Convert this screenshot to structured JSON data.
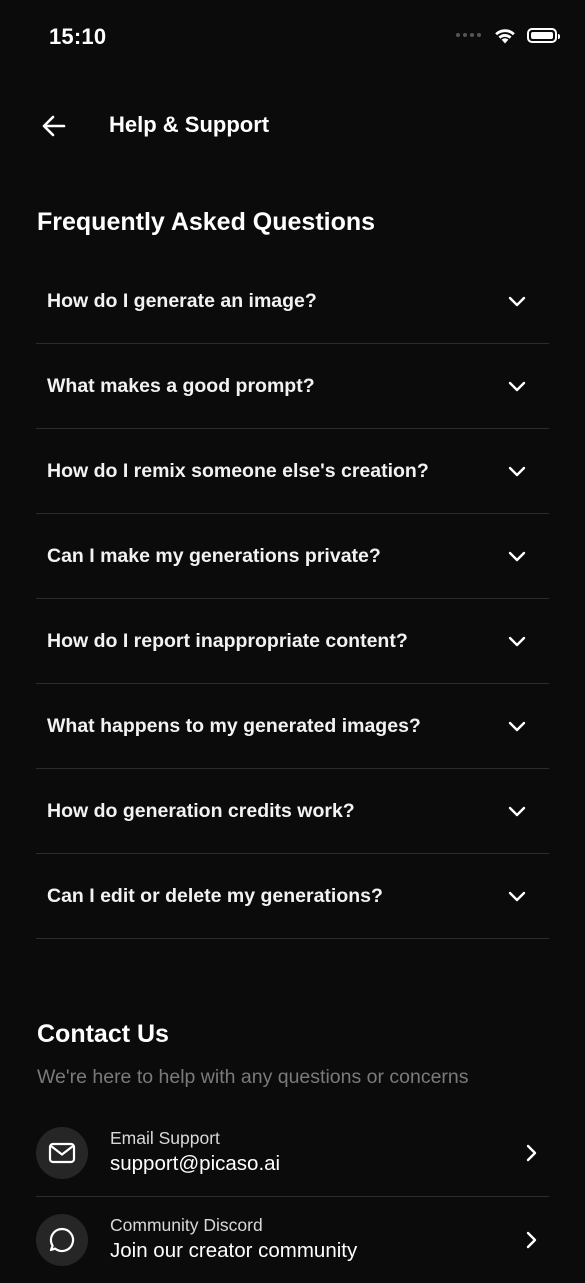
{
  "status_bar": {
    "time": "15:10"
  },
  "header": {
    "title": "Help & Support",
    "back_icon": "arrow-left-icon"
  },
  "faq": {
    "title": "Frequently Asked Questions",
    "items": [
      {
        "question": "How do I generate an image?"
      },
      {
        "question": "What makes a good prompt?"
      },
      {
        "question": "How do I remix someone else's creation?"
      },
      {
        "question": "Can I make my generations private?"
      },
      {
        "question": "How do I report inappropriate content?"
      },
      {
        "question": "What happens to my generated images?"
      },
      {
        "question": "How do generation credits work?"
      },
      {
        "question": "Can I edit or delete my generations?"
      }
    ]
  },
  "contact": {
    "title": "Contact Us",
    "subtitle": "We're here to help with any questions or concerns",
    "items": [
      {
        "label": "Email Support",
        "value": "support@picaso.ai",
        "icon": "mail-icon"
      },
      {
        "label": "Community Discord",
        "value": "Join our creator community",
        "icon": "chat-bubble-icon"
      }
    ]
  },
  "colors": {
    "background": "#0b0b0b",
    "text": "#ffffff",
    "muted": "#7a7a7a",
    "divider": "#2c2c2c",
    "icon_circle": "#262626"
  }
}
